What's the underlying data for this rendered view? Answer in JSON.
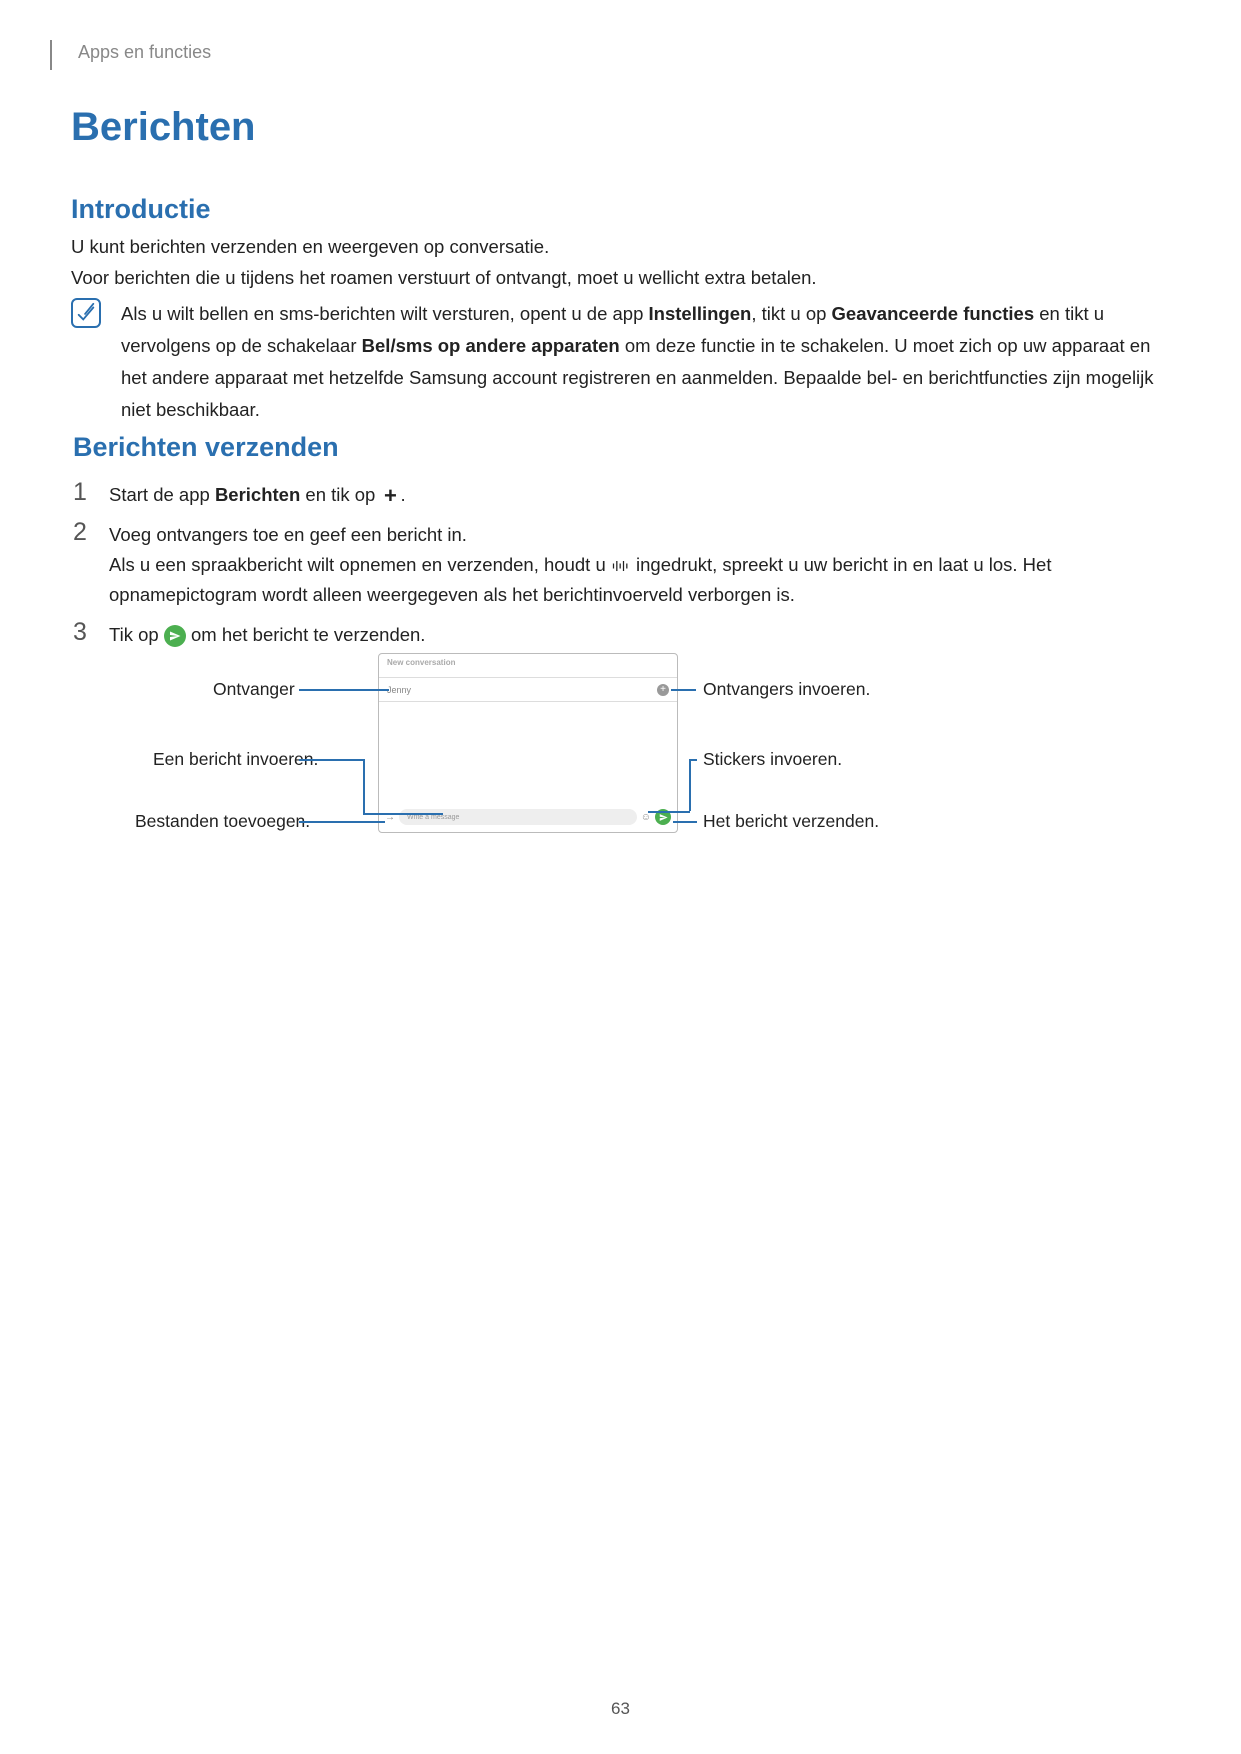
{
  "header": {
    "breadcrumb": "Apps en functies"
  },
  "title": "Berichten",
  "intro": {
    "heading": "Introductie",
    "p1": "U kunt berichten verzenden en weergeven op conversatie.",
    "p2": "Voor berichten die u tijdens het roamen verstuurt of ontvangt, moet u wellicht extra betalen.",
    "note_pre": "Als u wilt bellen en sms-berichten wilt versturen, opent u de app ",
    "note_b1": "Instellingen",
    "note_mid1": ", tikt u op ",
    "note_b2": "Geavanceerde functies",
    "note_mid2": " en tikt u vervolgens op de schakelaar ",
    "note_b3": "Bel/sms op andere apparaten",
    "note_post": " om deze functie in te schakelen. U moet zich op uw apparaat en het andere apparaat met hetzelfde Samsung account registreren en aanmelden. Bepaalde bel- en berichtfuncties zijn mogelijk niet beschikbaar."
  },
  "send": {
    "heading": "Berichten verzenden",
    "steps": {
      "n1": "1",
      "n2": "2",
      "n3": "3",
      "s1_pre": "Start de app ",
      "s1_b": "Berichten",
      "s1_mid": " en tik op ",
      "s1_post": ".",
      "s2_line1": "Voeg ontvangers toe en geef een bericht in.",
      "s2_line2_a": "Als u een spraakbericht wilt opnemen en verzenden, houdt u ",
      "s2_line2_b": " ingedrukt, spreekt u uw bericht in en laat u los. Het opnamepictogram wordt alleen weergegeven als het berichtinvoerveld verborgen is.",
      "s3_a": "Tik op ",
      "s3_b": " om het bericht te verzenden."
    }
  },
  "diagram": {
    "mock": {
      "header": "New conversation",
      "recipient": "Jenny",
      "input_placeholder": "Write a message"
    },
    "callouts": {
      "left1": "Ontvanger",
      "left2": "Een bericht invoeren.",
      "left3": "Bestanden toevoegen.",
      "right1": "Ontvangers invoeren.",
      "right2": "Stickers invoeren.",
      "right3": "Het bericht verzenden."
    }
  },
  "page_number": "63"
}
